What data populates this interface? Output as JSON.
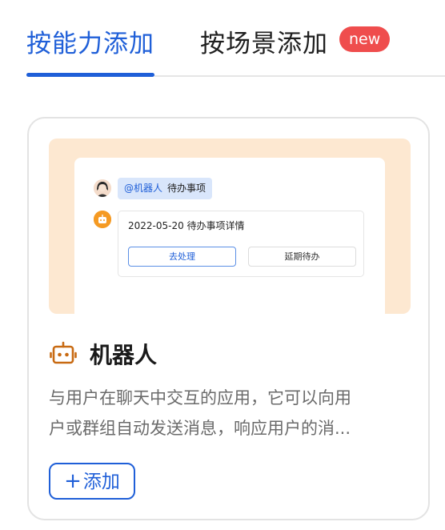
{
  "tabs": {
    "active_label": "按能力添加",
    "inactive_label": "按场景添加",
    "badge": "new"
  },
  "card": {
    "preview": {
      "mention_at": "@机器人",
      "mention_text": "待办事项",
      "message_title": "2022-05-20 待办事项详情",
      "primary_button": "去处理",
      "secondary_button": "延期待办"
    },
    "title": "机器人",
    "description_line1": "与用户在聊天中交互的应用，它可以向用",
    "description_line2": "户或群组自动发送消息，响应用户的消...",
    "add_button_plus": "+",
    "add_button_label": "添加"
  },
  "colors": {
    "accent": "#1f5fd8",
    "badge": "#ef4d4d",
    "preview_bg": "#fde8d1",
    "robot_icon": "#c86a12"
  },
  "icons": {
    "robot": "robot-icon",
    "avatar": "avatar"
  }
}
